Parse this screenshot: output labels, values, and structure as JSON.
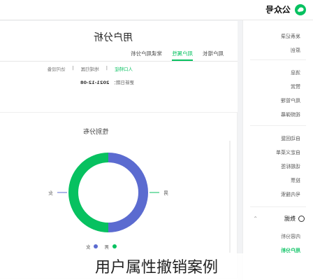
{
  "brand": {
    "name": "公众号"
  },
  "page": {
    "title": "用户分析"
  },
  "tabs": [
    {
      "label": "用户增长",
      "active": false
    },
    {
      "label": "用户属性",
      "active": true
    },
    {
      "label": "常读用户分析",
      "active": false
    }
  ],
  "filters": {
    "a": "人口特征",
    "b": "地域归属",
    "c": "访问设备"
  },
  "update": {
    "label": "更新日期：",
    "value": "2021-12-08"
  },
  "card": {
    "title": "性别分布"
  },
  "chart_data": {
    "type": "pie",
    "labels": [
      "男",
      "女"
    ],
    "values": [
      50,
      50
    ],
    "colors": [
      "#07c160",
      "#5b6bd0"
    ],
    "legend": "bottom"
  },
  "sidebar": {
    "items": [
      {
        "label": "发表记录",
        "active": false
      },
      {
        "label": "原创",
        "active": false
      },
      {
        "label": "消息",
        "active": false
      },
      {
        "label": "赞赏",
        "active": false
      },
      {
        "label": "用户管理",
        "active": false
      },
      {
        "label": "视频弹幕",
        "active": false
      },
      {
        "label": "自动回复",
        "active": false
      },
      {
        "label": "自定义菜单",
        "active": false
      },
      {
        "label": "话题标签",
        "active": false
      },
      {
        "label": "投票",
        "active": false
      },
      {
        "label": "号内搜索",
        "active": false
      }
    ],
    "section": "数据",
    "section_items": [
      {
        "label": "内容分析",
        "active": false
      },
      {
        "label": "用户分析",
        "active": true
      }
    ]
  },
  "caption": "用户属性撤销案例"
}
